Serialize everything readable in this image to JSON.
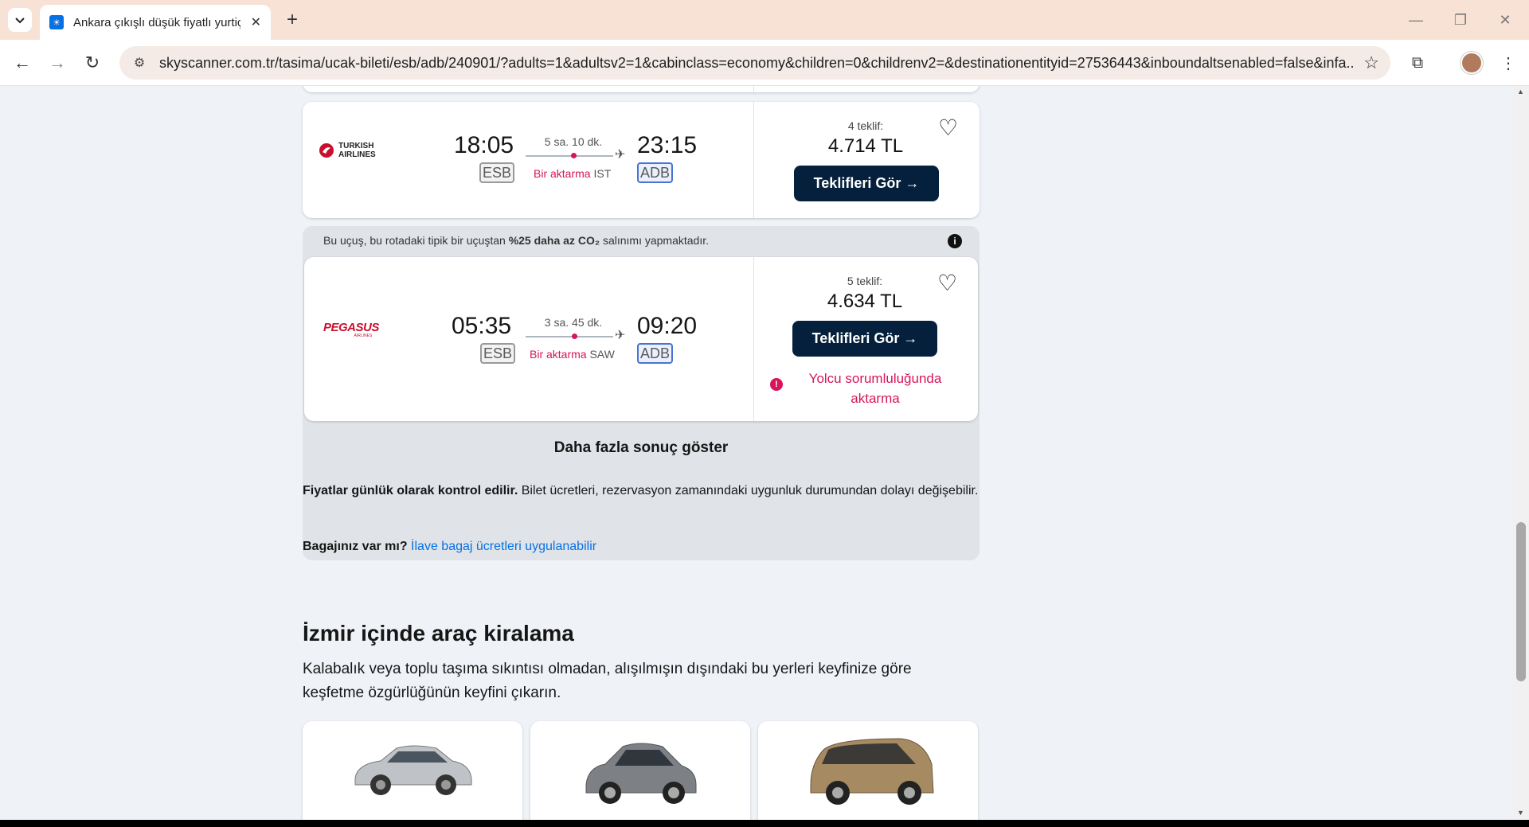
{
  "browser": {
    "tab_title": "Ankara çıkışlı düşük fiyatlı yurtiç",
    "url": "skyscanner.com.tr/tasima/ucak-bileti/esb/adb/240901/?adults=1&adultsv2=1&cabinclass=economy&children=0&childrenv2=&destinationentityid=27536443&inboundaltsenabled=false&infa..."
  },
  "flights": [
    {
      "airline": "TURKISH AIRLINES",
      "airline_line1": "TURKISH",
      "airline_line2": "AIRLINES",
      "depart_time": "18:05",
      "depart_code": "ESB",
      "arrive_time": "23:15",
      "arrive_code": "ADB",
      "duration": "5 sa. 10 dk.",
      "stops_label": "Bir aktarma",
      "stop_hub": "IST",
      "offers": "4 teklif:",
      "price": "4.714 TL",
      "cta": "Teklifleri Gör →"
    },
    {
      "airline": "PEGASUS",
      "airline_sub": "AIRLINES",
      "co2_prefix": "Bu uçuş, bu rotadaki tipik bir uçuştan ",
      "co2_bold": "%25 daha az CO₂",
      "co2_suffix": " salınımı yapmaktadır.",
      "depart_time": "05:35",
      "depart_code": "ESB",
      "arrive_time": "09:20",
      "arrive_code": "ADB",
      "duration": "3 sa. 45 dk.",
      "stops_label": "Bir aktarma",
      "stop_hub": "SAW",
      "offers": "5 teklif:",
      "price": "4.634 TL",
      "cta": "Teklifleri Gör →",
      "warning": "Yolcu sorumluluğunda aktarma"
    }
  ],
  "more_results": "Daha fazla sonuç göster",
  "notes": {
    "price_bold": "Fiyatlar günlük olarak kontrol edilir.",
    "price_text": " Bilet ücretleri, rezervasyon zamanındaki uygunluk durumundan dolayı değişebilir.",
    "bag_bold": "Bagajınız var mı?",
    "bag_link": "İlave bagaj ücretleri uygulanabilir"
  },
  "car_section": {
    "title": "İzmir içinde araç kiralama",
    "subtitle": "Kalabalık veya toplu taşıma sıkıntısı olmadan, alışılmışın dışındaki bu yerleri keyfinize göre keşfetme özgürlüğünün keyfini çıkarın."
  },
  "colors": {
    "brand_dark": "#05203c",
    "alert_pink": "#d6155b",
    "link_blue": "#0770e3",
    "page_bg": "#eff3f8"
  }
}
